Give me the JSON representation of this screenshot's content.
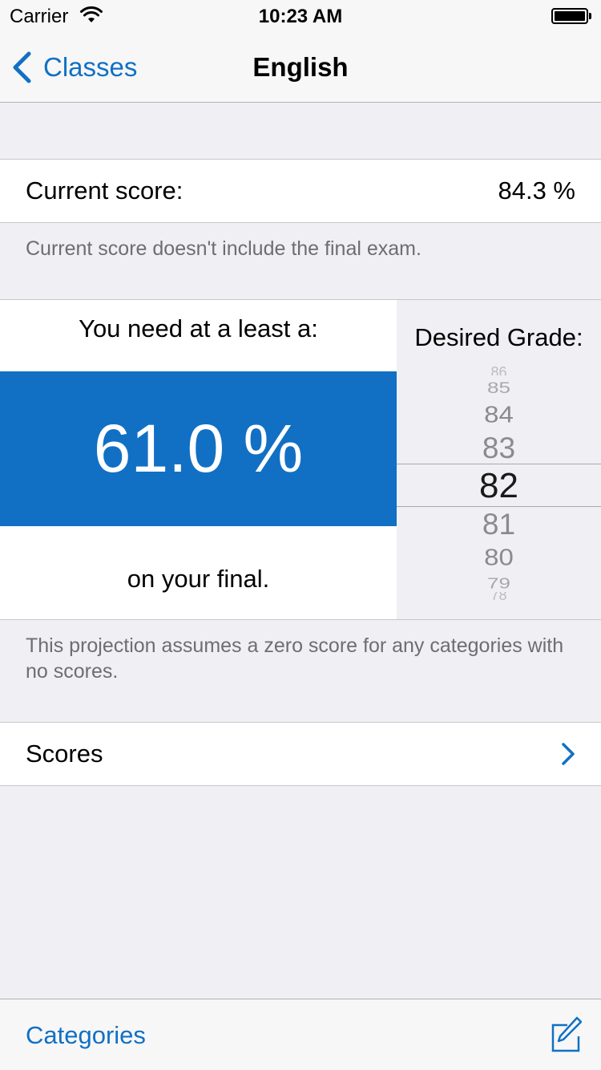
{
  "status_bar": {
    "carrier": "Carrier",
    "time": "10:23 AM"
  },
  "nav": {
    "back_label": "Classes",
    "title": "English"
  },
  "current": {
    "label": "Current score:",
    "value": "84.3 %",
    "footnote": "Current score doesn't include the final exam."
  },
  "projection": {
    "need_label": "You need at a least a:",
    "result": "61.0 %",
    "final_label": "on your final.",
    "desired_label": "Desired Grade:",
    "picker": {
      "items": [
        "86",
        "85",
        "84",
        "83",
        "82",
        "81",
        "80",
        "79",
        "78"
      ],
      "selected": "82"
    },
    "footnote": "This projection assumes a zero score for any categories with no scores."
  },
  "scores_cell": {
    "label": "Scores"
  },
  "toolbar": {
    "categories_label": "Categories"
  },
  "colors": {
    "accent": "#1170c4",
    "background": "#efeff4",
    "cell": "#ffffff"
  },
  "icons": {
    "wifi": "wifi-icon",
    "battery": "battery-icon",
    "back": "chevron-left-icon",
    "disclosure": "chevron-right-icon",
    "compose": "compose-icon"
  }
}
